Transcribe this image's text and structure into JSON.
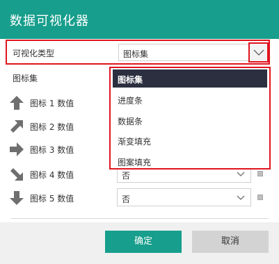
{
  "window": {
    "title": "数据可视化器"
  },
  "visualization_type": {
    "label": "可视化类型",
    "selected": "图标集",
    "options": [
      "图标集",
      "进度条",
      "数据条",
      "渐变填充",
      "图案填充"
    ]
  },
  "icon_set": {
    "section_label": "图标集",
    "rows": [
      {
        "label": "图标 1 数值",
        "icon": "arrow-up-icon",
        "value": ""
      },
      {
        "label": "图标 2 数值",
        "icon": "arrow-up-right-icon",
        "value": ""
      },
      {
        "label": "图标 3 数值",
        "icon": "arrow-right-icon",
        "value": ""
      },
      {
        "label": "图标 4 数值",
        "icon": "arrow-down-right-icon",
        "value": "否"
      },
      {
        "label": "图标 5 数值",
        "icon": "arrow-down-icon",
        "value": "否"
      }
    ]
  },
  "footer": {
    "ok_label": "确定",
    "cancel_label": "取消"
  },
  "colors": {
    "accent": "#179e8c",
    "highlight_border": "#e0141e",
    "selected_option": "#2c2f40",
    "icon_gray": "#6f6f6f"
  }
}
